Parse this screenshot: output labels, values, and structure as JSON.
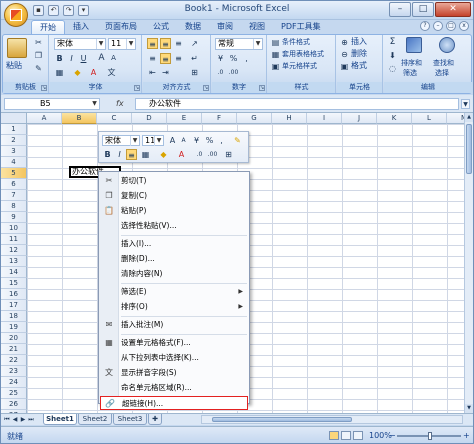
{
  "window": {
    "title": "Book1 - Microsoft Excel"
  },
  "qat": {
    "save_icon": "save-icon",
    "undo_icon": "undo-icon",
    "redo_icon": "redo-icon",
    "more": "▾"
  },
  "window_controls": {
    "minimize": "–",
    "maximize": "□",
    "close": "✕"
  },
  "ribbon_tabs": [
    {
      "label": "开始",
      "active": true
    },
    {
      "label": "插入"
    },
    {
      "label": "页面布局"
    },
    {
      "label": "公式"
    },
    {
      "label": "数据"
    },
    {
      "label": "审阅"
    },
    {
      "label": "视图"
    },
    {
      "label": "PDF工具集"
    }
  ],
  "ribbon": {
    "clipboard": {
      "label": "剪贴板",
      "paste": "粘贴"
    },
    "font": {
      "label": "字体",
      "name": "宋体",
      "size": "11",
      "bold": "B",
      "italic": "I",
      "underline": "U",
      "grow": "A",
      "shrink": "A"
    },
    "alignment": {
      "label": "对齐方式"
    },
    "number": {
      "label": "数字",
      "format": "常规",
      "percent": "%",
      "comma": ","
    },
    "styles": {
      "label": "样式",
      "conditional": "条件格式",
      "table": "套用表格格式",
      "cell": "单元格样式"
    },
    "cells": {
      "label": "单元格",
      "insert": "插入",
      "delete": "删除",
      "format": "格式"
    },
    "editing": {
      "label": "编辑",
      "sigma": "Σ",
      "sort": "排序和",
      "sort2": "筛选",
      "find": "查找和",
      "find2": "选择"
    }
  },
  "formula_bar": {
    "name_box": "B5",
    "fx": "fx",
    "content": "办公软件"
  },
  "columns": [
    "A",
    "B",
    "C",
    "D",
    "E",
    "F",
    "G",
    "H",
    "I",
    "J",
    "K",
    "L",
    "M"
  ],
  "selected_column": "B",
  "rows": [
    "1",
    "2",
    "3",
    "4",
    "5",
    "6",
    "7",
    "8",
    "9",
    "10",
    "11",
    "12",
    "13",
    "14",
    "15",
    "16",
    "17",
    "18",
    "19",
    "20",
    "21",
    "22",
    "23",
    "24",
    "25",
    "26",
    "27"
  ],
  "selected_row": "5",
  "active_cell": {
    "ref": "B5",
    "text": "办公软件"
  },
  "mini_toolbar": {
    "font": "宋体",
    "size": "11"
  },
  "context_menu": [
    {
      "label": "剪切(T)",
      "icon": "scissors-icon"
    },
    {
      "label": "复制(C)",
      "icon": "copy-icon"
    },
    {
      "label": "粘贴(P)",
      "icon": "paste-icon"
    },
    {
      "label": "选择性粘贴(V)...",
      "icon": ""
    },
    {
      "label": "插入(I)...",
      "icon": ""
    },
    {
      "label": "删除(D)...",
      "icon": ""
    },
    {
      "label": "清除内容(N)",
      "icon": ""
    },
    {
      "label": "筛选(E)",
      "icon": "",
      "submenu": true
    },
    {
      "label": "排序(O)",
      "icon": "",
      "submenu": true
    },
    {
      "label": "插入批注(M)",
      "icon": "comment-icon"
    },
    {
      "label": "设置单元格格式(F)...",
      "icon": "format-cells-icon"
    },
    {
      "label": "从下拉列表中选择(K)...",
      "icon": ""
    },
    {
      "label": "显示拼音字段(S)",
      "icon": "phonetic-icon"
    },
    {
      "label": "命名单元格区域(R)...",
      "icon": ""
    },
    {
      "label": "超链接(H)...",
      "icon": "hyperlink-icon",
      "highlighted": true
    }
  ],
  "sheet_tabs": [
    "Sheet1",
    "Sheet2",
    "Sheet3"
  ],
  "active_sheet": "Sheet1",
  "status": {
    "text": "就绪",
    "zoom": "100%"
  },
  "colors": {
    "highlight_border": "#e32121",
    "accent": "#15428b"
  }
}
